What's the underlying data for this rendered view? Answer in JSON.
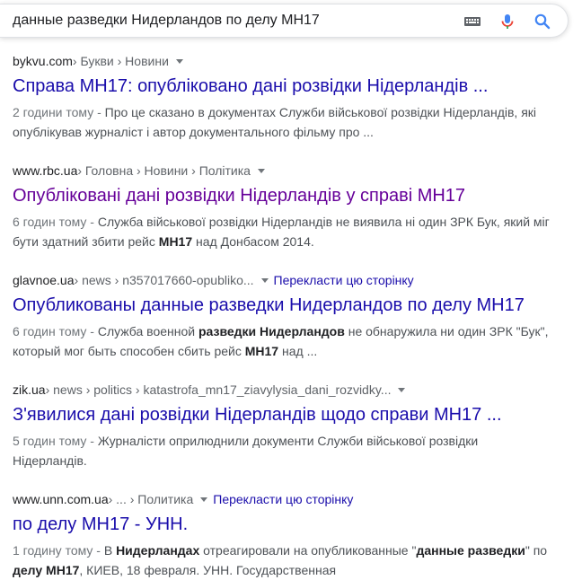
{
  "search": {
    "query": "данные разведки Нидерландов по делу МН17"
  },
  "icons": {
    "keyboard": "keyboard-icon",
    "mic": "microphone-icon",
    "search": "search-icon"
  },
  "colors": {
    "link": "#1a0dab",
    "visited": "#660099",
    "snippet": "#4d5156"
  },
  "results": [
    {
      "domain": "bykvu.com",
      "path": " › Букви › Новини",
      "title": "Справа MH17: опубліковано дані розвідки Нідерландів ...",
      "date": "2 години тому - ",
      "line1": "Про це сказано в документах Служби військової розвідки Нідерландів, які",
      "line2": "опублікував журналіст і автор документального фільму про ..."
    },
    {
      "domain": "www.rbc.ua",
      "path": " › Головна › Новини › Політика",
      "title": "Опубліковані дані розвідки Нідерландів у справі MH17",
      "date": "6 годин тому - ",
      "line1": "Служба військової розвідки Нідерландів не виявила ні один ЗРК Бук, який міг",
      "line2_a": "бути здатний збити рейс ",
      "line2_b": "MH17",
      "line2_c": " над Донбасом 2014."
    },
    {
      "domain": "glavnoe.ua",
      "path": " › news › n357017660-opubliko...",
      "translate": "Перекласти цю сторінку",
      "title": "Опубликованы данные разведки Нидерландов по делу MH17",
      "date": "6 годин тому - ",
      "line1_a": "Служба военной ",
      "line1_b": "разведки Нидерландов",
      "line1_c": " не обнаружила ни один ЗРК \"Бук\",",
      "line2_a": "который мог быть способен сбить рейс ",
      "line2_b": "МН17",
      "line2_c": " над ..."
    },
    {
      "domain": "zik.ua",
      "path": " › news › politics › katastrofa_mn17_ziavylysia_dani_rozvidky...",
      "title": "З'явилися дані розвідки Нідерландів щодо справи MH17 ...",
      "date": "5 годин тому - ",
      "line1": "Журналісти оприлюднили документи Служби військової розвідки",
      "line2": "Нідерландів."
    },
    {
      "domain": "www.unn.com.ua",
      "path": " › ... › Политика",
      "translate": "Перекласти цю сторінку",
      "title": "по делу МН17 - УНН.",
      "date": "1 годину тому - ",
      "line1_a": "В ",
      "line1_b": "Нидерландах",
      "line1_c": " отреагировали на опубликованные \"",
      "line1_d": "данные разведки",
      "line1_e": "\" по",
      "line2_a": "делу МН17",
      "line2_b": ", КИЕВ, 18 февраля. УНН. Государственная"
    }
  ]
}
